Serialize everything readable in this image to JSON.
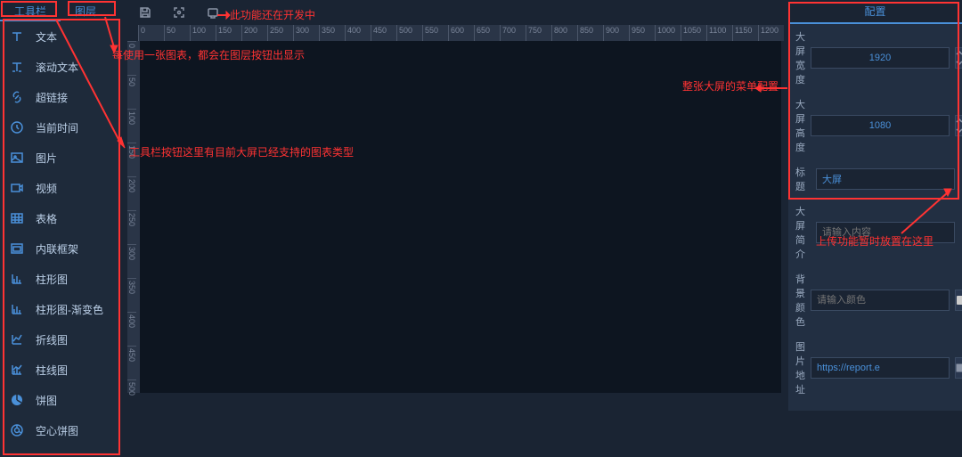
{
  "tabs": {
    "toolbar": "工具栏",
    "layers": "图层"
  },
  "sidebar": {
    "items": [
      {
        "label": "文本"
      },
      {
        "label": "滚动文本"
      },
      {
        "label": "超链接"
      },
      {
        "label": "当前时间"
      },
      {
        "label": "图片"
      },
      {
        "label": "视频"
      },
      {
        "label": "表格"
      },
      {
        "label": "内联框架"
      },
      {
        "label": "柱形图"
      },
      {
        "label": "柱形图-渐变色"
      },
      {
        "label": "折线图"
      },
      {
        "label": "柱线图"
      },
      {
        "label": "饼图"
      },
      {
        "label": "空心饼图"
      }
    ]
  },
  "ruler": {
    "h": [
      "0",
      "50",
      "100",
      "150",
      "200",
      "250",
      "300",
      "350",
      "400",
      "450",
      "500",
      "550",
      "600",
      "650",
      "700",
      "750",
      "800",
      "850",
      "900",
      "950",
      "1000",
      "1050",
      "1100",
      "1150",
      "1200"
    ],
    "v": [
      "0",
      "50",
      "100",
      "150",
      "200",
      "250",
      "300",
      "350",
      "400",
      "450",
      "500"
    ]
  },
  "config": {
    "title": "配置",
    "rows": {
      "width_label": "大屏宽度",
      "width_value": "1920",
      "height_label": "大屏高度",
      "height_value": "1080",
      "title_label": "标题",
      "title_value": "大屏",
      "intro_label": "大屏简介",
      "intro_placeholder": "请输入内容",
      "bgcolor_label": "背景颜色",
      "bgcolor_placeholder": "请输入颜色",
      "imgurl_label": "图片地址",
      "imgurl_value": "https://report.e"
    }
  },
  "annotations": {
    "dev": "此功能还在开发中",
    "layers": "每使用一张图表，都会在图层按钮出显示",
    "toolbar": "工具栏按钮这里有目前大屏已经支持的图表类型",
    "config": "整张大屏的菜单配置",
    "upload": "上传功能暂时放置在这里"
  }
}
